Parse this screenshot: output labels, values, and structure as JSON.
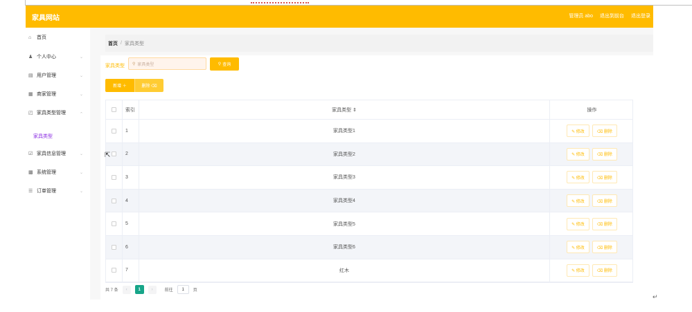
{
  "header": {
    "logo": "家具网站",
    "links": [
      "管理员 abo",
      "退出到前台",
      "退出登录"
    ]
  },
  "sidebar": {
    "items": [
      {
        "icon": "home-icon",
        "glyph": "⌂",
        "label": "首页",
        "chevron": false
      },
      {
        "icon": "user-icon",
        "glyph": "♟",
        "label": "个人中心",
        "chevron": true
      },
      {
        "icon": "users-icon",
        "glyph": "▤",
        "label": "用户管理",
        "chevron": true
      },
      {
        "icon": "shop-icon",
        "glyph": "▦",
        "label": "商家管理",
        "chevron": true
      },
      {
        "icon": "category-icon",
        "glyph": "◰",
        "label": "家具类型管理",
        "chevron": true
      },
      {
        "icon": "info-icon",
        "glyph": "☑",
        "label": "家具信息管理",
        "chevron": true
      },
      {
        "icon": "system-icon",
        "glyph": "▩",
        "label": "系统管理",
        "chevron": true
      },
      {
        "icon": "order-icon",
        "glyph": "☰",
        "label": "订单管理",
        "chevron": true
      }
    ],
    "sub_item": "家具类型",
    "chevron_glyph": "⌄"
  },
  "breadcrumb": {
    "home": "首页",
    "separator": "/",
    "current": "家具类型"
  },
  "search": {
    "label": "家具类型",
    "placeholder": "家具类型",
    "search_glyph": "⚲",
    "query_label": "查询"
  },
  "actions": {
    "add_label": "新增 ＋",
    "delete_label": "删除 ⌫"
  },
  "table": {
    "headers": {
      "index": "索引",
      "name": "家具类型 ⇕",
      "ops": "操作"
    },
    "rows": [
      {
        "index": "1",
        "name": "家具类型1"
      },
      {
        "index": "2",
        "name": "家具类型2"
      },
      {
        "index": "3",
        "name": "家具类型3"
      },
      {
        "index": "4",
        "name": "家具类型4"
      },
      {
        "index": "5",
        "name": "家具类型5"
      },
      {
        "index": "6",
        "name": "家具类型6"
      },
      {
        "index": "7",
        "name": "红木"
      }
    ],
    "edit_label": "✎ 修改",
    "delete_label": "⌫ 删除"
  },
  "pagination": {
    "total": "共 7 条",
    "prev": "‹",
    "next": "›",
    "current_page": "1",
    "goto_label": "前往",
    "goto_value": "1",
    "page_suffix": "页"
  },
  "colors": {
    "accent": "#ffbb00",
    "active_page": "#17a589",
    "submenu": "#8a2be2"
  }
}
